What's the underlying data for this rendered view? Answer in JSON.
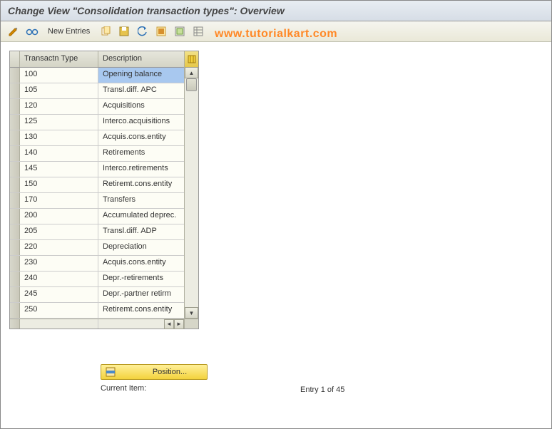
{
  "title": "Change View \"Consolidation transaction types\": Overview",
  "toolbar": {
    "new_entries_label": "New Entries"
  },
  "watermark": "www.tutorialkart.com",
  "table": {
    "col_type": "Transactn Type",
    "col_desc": "Description",
    "rows": [
      {
        "type": "100",
        "desc": "Opening balance",
        "selected": true
      },
      {
        "type": "105",
        "desc": "Transl.diff. APC"
      },
      {
        "type": "120",
        "desc": "Acquisitions"
      },
      {
        "type": "125",
        "desc": "Interco.acquisitions"
      },
      {
        "type": "130",
        "desc": "Acquis.cons.entity"
      },
      {
        "type": "140",
        "desc": "Retirements"
      },
      {
        "type": "145",
        "desc": "Interco.retirements"
      },
      {
        "type": "150",
        "desc": "Retiremt.cons.entity"
      },
      {
        "type": "170",
        "desc": "Transfers"
      },
      {
        "type": "200",
        "desc": "Accumulated deprec."
      },
      {
        "type": "205",
        "desc": "Transl.diff. ADP"
      },
      {
        "type": "220",
        "desc": "Depreciation"
      },
      {
        "type": "230",
        "desc": "Acquis.cons.entity"
      },
      {
        "type": "240",
        "desc": "Depr.-retirements"
      },
      {
        "type": "245",
        "desc": "Depr.-partner retirm"
      },
      {
        "type": "250",
        "desc": "Retiremt.cons.entity"
      }
    ]
  },
  "footer": {
    "position_label": "Position...",
    "current_item_label": "Current Item:",
    "entry_info": "Entry 1 of 45"
  }
}
